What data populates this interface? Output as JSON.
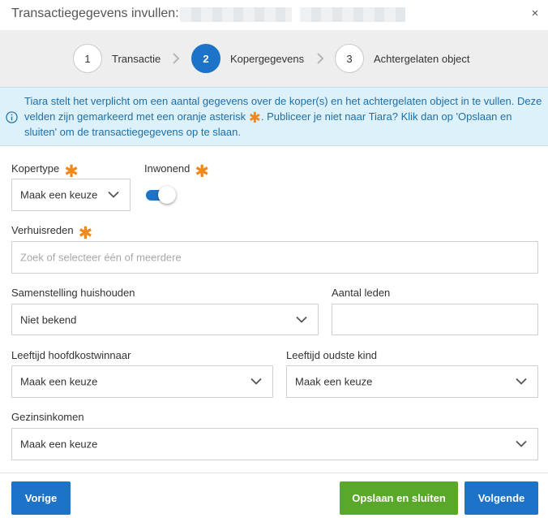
{
  "dialog": {
    "title": "Transactiegegevens invullen:",
    "close_glyph": "×"
  },
  "steps": [
    {
      "number": "1",
      "label": "Transactie",
      "active": false
    },
    {
      "number": "2",
      "label": "Kopergegevens",
      "active": true
    },
    {
      "number": "3",
      "label": "Achtergelaten object",
      "active": false
    }
  ],
  "info": {
    "icon": "info-icon",
    "text_part1": "Tiara stelt het verplicht om een aantal gegevens over de koper(s) en het achtergelaten object in te vullen. Deze velden zijn gemarkeerd met een oranje asterisk ",
    "asterisk": "✱",
    "text_part2": ". Publiceer je niet naar Tiara? Klik dan op 'Opslaan en sluiten' om de transactiegegevens op te slaan."
  },
  "form": {
    "kopertype": {
      "label": "Kopertype",
      "value": "Maak een keuze"
    },
    "inwonend": {
      "label": "Inwonend",
      "on": true
    },
    "verhuisreden": {
      "label": "Verhuisreden",
      "placeholder": "Zoek of selecteer één of meerdere"
    },
    "samenstelling": {
      "label": "Samenstelling huishouden",
      "value": "Niet bekend"
    },
    "aantal_leden": {
      "label": "Aantal leden",
      "value": ""
    },
    "leeftijd_hoofd": {
      "label": "Leeftijd hoofdkostwinnaar",
      "value": "Maak een keuze"
    },
    "leeftijd_kind": {
      "label": "Leeftijd oudste kind",
      "value": "Maak een keuze"
    },
    "gezinsinkomen": {
      "label": "Gezinsinkomen",
      "value": "Maak een keuze"
    },
    "required_glyph": "✱"
  },
  "footer": {
    "back": "Vorige",
    "save_close": "Opslaan en sluiten",
    "next": "Volgende"
  },
  "colors": {
    "primary": "#1d73c7",
    "success": "#5aa829",
    "required": "#f0891c",
    "info_bg": "#dcf1fa",
    "info_text": "#1f6ea6"
  }
}
